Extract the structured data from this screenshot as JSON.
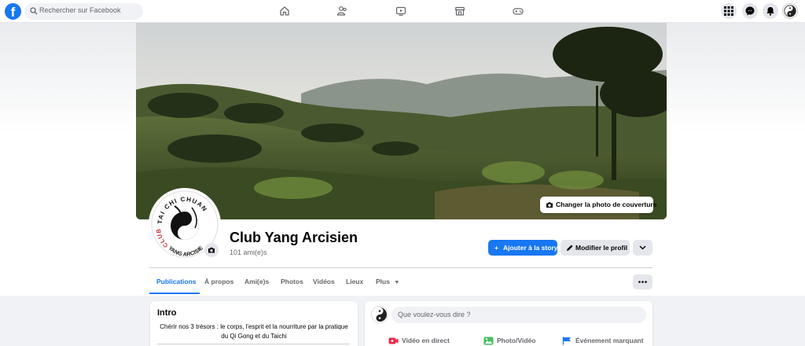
{
  "topbar": {
    "logo_letter": "f",
    "search_placeholder": "Rechercher sur Facebook",
    "nav_icons": [
      "home-icon",
      "friends-icon",
      "watch-icon",
      "marketplace-icon",
      "gaming-icon"
    ],
    "right_icons": [
      "menu-grid-icon",
      "messenger-icon",
      "notifications-icon",
      "account-avatar"
    ]
  },
  "cover": {
    "change_cover_label": "Changer la photo de couverture"
  },
  "profile": {
    "name": "Club Yang Arcisien",
    "friends": "101 ami(e)s",
    "logo_text_top": "TAI CHI CHUAN",
    "logo_text_left": "CLUB",
    "logo_text_bottom": "YANG ARCISIEN"
  },
  "actions": {
    "add_story": "Ajouter à la story",
    "edit_profile": "Modifier le profil"
  },
  "tabs": [
    {
      "label": "Publications"
    },
    {
      "label": "À propos"
    },
    {
      "label": "Ami(e)s"
    },
    {
      "label": "Photos"
    },
    {
      "label": "Vidéos"
    },
    {
      "label": "Lieux"
    },
    {
      "label": "Plus"
    }
  ],
  "intro": {
    "title": "Intro",
    "bio": "Chérir nos 3 trésors : le corps, l'esprit et la nourriture par la pratique du Qi Gong et du Taichi"
  },
  "composer": {
    "placeholder": "Que voulez-vous dire ?",
    "live_video": "Vidéo en direct",
    "photo_video": "Photo/Vidéo",
    "life_event": "Événement marquant"
  },
  "colors": {
    "brand": "#1877f2",
    "live": "#f02849",
    "photo": "#45bd62",
    "event": "#1877f2"
  }
}
